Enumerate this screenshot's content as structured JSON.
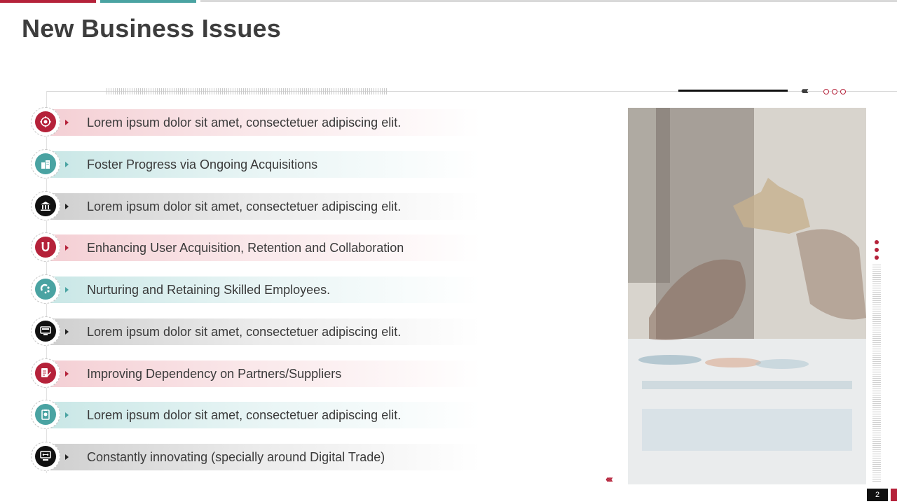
{
  "title": "New Business Issues",
  "page_number": "2",
  "colors": {
    "accent_red": "#b5223a",
    "accent_teal": "#4aa3a2",
    "accent_black": "#111111"
  },
  "items": [
    {
      "label": "Lorem ipsum dolor sit amet, consectetuer adipiscing elit.",
      "color": "red",
      "icon": "target-icon"
    },
    {
      "label": "Foster Progress via Ongoing Acquisitions",
      "color": "teal",
      "icon": "buildings-icon"
    },
    {
      "label": "Lorem ipsum dolor sit amet, consectetuer adipiscing elit.",
      "color": "black",
      "icon": "bank-chart-icon"
    },
    {
      "label": "Enhancing User Acquisition, Retention and Collaboration",
      "color": "red",
      "icon": "magnet-icon"
    },
    {
      "label": "Nurturing and Retaining Skilled Employees.",
      "color": "teal",
      "icon": "magnet-people-icon"
    },
    {
      "label": "Lorem ipsum dolor sit amet, consectetuer adipiscing elit.",
      "color": "black",
      "icon": "monitor-icon"
    },
    {
      "label": "Improving Dependency on Partners/Suppliers",
      "color": "red",
      "icon": "document-edit-icon"
    },
    {
      "label": "Lorem ipsum dolor sit amet, consectetuer adipiscing elit.",
      "color": "teal",
      "icon": "clipboard-badge-icon"
    },
    {
      "label": "Constantly innovating (specially around Digital Trade)",
      "color": "black",
      "icon": "computer-network-icon"
    }
  ]
}
